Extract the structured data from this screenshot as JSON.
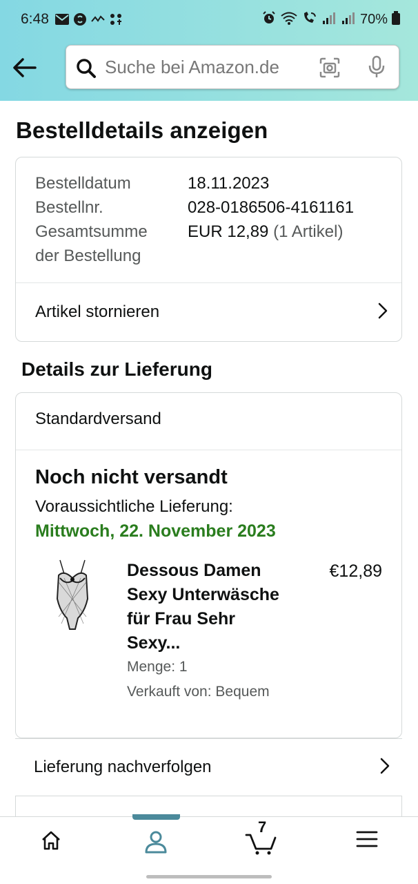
{
  "status_bar": {
    "time": "6:48",
    "battery": "70%"
  },
  "search": {
    "placeholder": "Suche bei Amazon.de"
  },
  "page": {
    "title": "Bestelldetails anzeigen"
  },
  "order_summary": {
    "date_label": "Bestelldatum",
    "date_value": "18.11.2023",
    "number_label": "Bestellnr.",
    "number_value": "028-0186506-4161161",
    "total_label_line1": "Gesamtsumme",
    "total_label_line2": "der Bestellung",
    "total_value": "EUR 12,89",
    "total_items": "(1 Artikel)",
    "cancel_label": "Artikel stornieren"
  },
  "delivery": {
    "section_title": "Details zur Lieferung",
    "shipping_method": "Standardversand",
    "status": "Noch nicht versandt",
    "eta_label": "Voraussichtliche Lieferung:",
    "eta_date": "Mittwoch, 22. November 2023",
    "eta_color": "#2a7d1e",
    "item": {
      "title": "Dessous Damen Sexy Unterwäsche für Frau Sehr Sexy...",
      "price": "€12,89",
      "quantity": "Menge: 1",
      "seller": "Verkauft von: Bequem"
    },
    "track_label": "Lieferung nachverfolgen"
  },
  "bottom_nav": {
    "items": [
      "home-icon",
      "account-icon",
      "cart-icon",
      "menu-icon"
    ],
    "active": "account-icon",
    "active_color": "#4b8a9b",
    "cart_count": "7"
  }
}
